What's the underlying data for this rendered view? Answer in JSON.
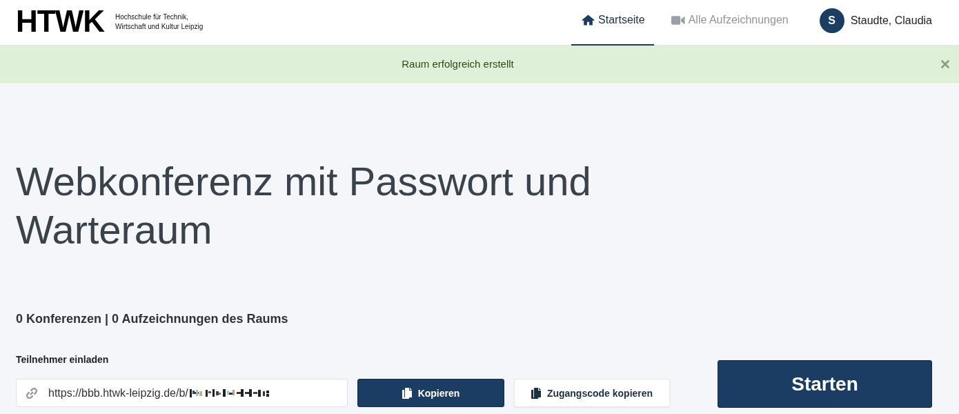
{
  "header": {
    "logo": {
      "wordmark": "HTWK",
      "subtitle_lines": [
        "Hochschule für Technik,",
        "Wirtschaft und Kultur Leipzig"
      ]
    },
    "nav": [
      {
        "label": "Startseite",
        "selected": true
      },
      {
        "label": "Alle Aufzeichnungen",
        "selected": false
      }
    ],
    "user": {
      "initial": "S",
      "name": "Staudte, Claudia"
    }
  },
  "alert": {
    "message": "Raum erfolgreich erstellt",
    "dismissible": true
  },
  "room": {
    "title": "Webkonferenz mit Passwort und Warteraum",
    "stats": "0 Konferenzen | 0 Aufzeichnungen des Raums"
  },
  "invite": {
    "label": "Teilnehmer einladen",
    "url": "https://bbb.htwk-leipzig.de/b/",
    "url_redacted": true,
    "buttons": [
      {
        "label": "Kopieren",
        "kind": "primary"
      },
      {
        "label": "Zugangscode kopieren",
        "kind": "secondary"
      }
    ]
  },
  "start_button": {
    "label": "Starten"
  }
}
